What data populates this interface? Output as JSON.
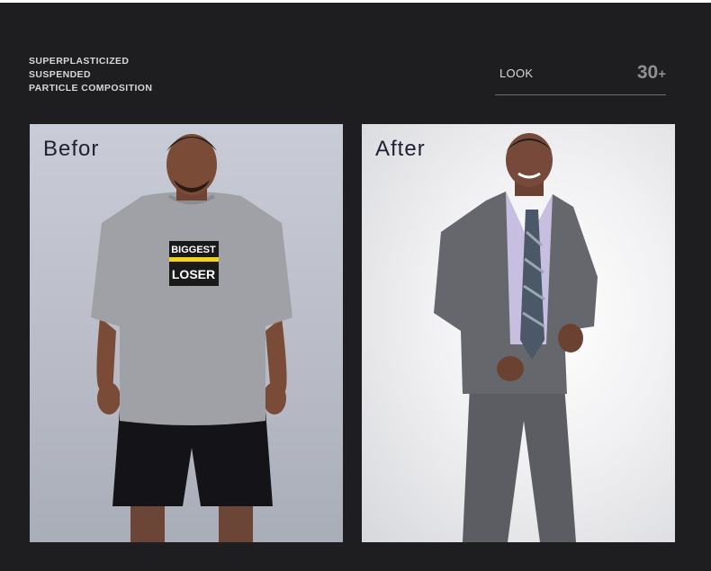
{
  "header": {
    "subtitle_lines": [
      "SUPERPLASTICIZED",
      "SUSPENDED",
      "PARTICLE COMPOSITION"
    ],
    "look_label": "LOOK",
    "look_number": "30",
    "look_plus": "+"
  },
  "panels": {
    "before_label": "Befor",
    "after_label": "After",
    "shirt_text_line1": "BIGGEST",
    "shirt_text_line2": "LOSER"
  }
}
